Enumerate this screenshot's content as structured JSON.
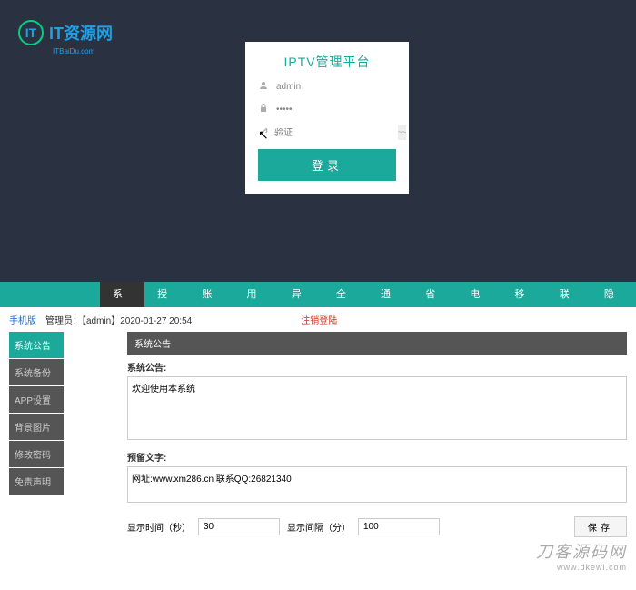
{
  "logo": {
    "icon_text": "IT",
    "title": "IT资源网",
    "subtitle": "ITBaiDu.com"
  },
  "login": {
    "title": "IPTV管理平台",
    "username": "admin",
    "password": "•••••",
    "captcha_placeholder": "验证",
    "button": "登录"
  },
  "nav": {
    "items": [
      "系统",
      "授权",
      "账号",
      "用户",
      "异常",
      "全网",
      "通用",
      "省内",
      "电信",
      "移动",
      "联通",
      "隐藏"
    ],
    "active_index": 0
  },
  "info": {
    "mobile": "手机版",
    "admin": "管理员：【admin】2020-01-27 20:54",
    "logout": "注销登陆"
  },
  "sidebar": {
    "items": [
      "系统公告",
      "系统备份",
      "APP设置",
      "背景图片",
      "修改密码",
      "免责声明"
    ],
    "active_index": 0
  },
  "panel": {
    "header": "系统公告",
    "field1_label": "系统公告:",
    "field1_value": "欢迎使用本系统",
    "field2_label": "预留文字:",
    "field2_value": "网址:www.xm286.cn 联系QQ:26821340",
    "display_time_label": "显示时间（秒）",
    "display_time_value": "30",
    "display_interval_label": "显示间隔（分）",
    "display_interval_value": "100",
    "save": "保存"
  },
  "watermark": {
    "main": "刀客源码网",
    "url": "www.dkewl.com"
  }
}
